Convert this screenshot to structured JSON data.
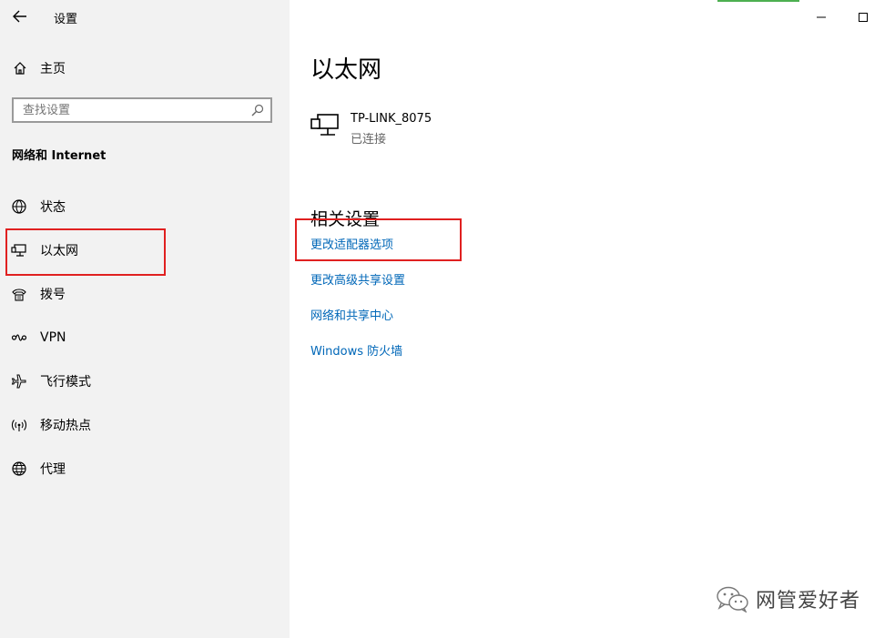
{
  "window": {
    "title": "设置",
    "accent_color": "#0067b8",
    "highlight_color": "#e02020"
  },
  "sidebar": {
    "home_label": "主页",
    "search_placeholder": "查找设置",
    "section_title": "网络和 Internet",
    "items": [
      {
        "label": "状态",
        "icon": "status-globe-icon"
      },
      {
        "label": "以太网",
        "icon": "ethernet-icon"
      },
      {
        "label": "拨号",
        "icon": "dialup-icon"
      },
      {
        "label": "VPN",
        "icon": "vpn-icon"
      },
      {
        "label": "飞行模式",
        "icon": "airplane-icon"
      },
      {
        "label": "移动热点",
        "icon": "hotspot-icon"
      },
      {
        "label": "代理",
        "icon": "proxy-globe-icon"
      }
    ]
  },
  "main": {
    "title": "以太网",
    "network": {
      "name": "TP-LINK_8075",
      "status": "已连接"
    },
    "related_title": "相关设置",
    "links": [
      "更改适配器选项",
      "更改高级共享设置",
      "网络和共享中心",
      "Windows 防火墙"
    ]
  },
  "watermark": {
    "text": "网管爱好者"
  }
}
